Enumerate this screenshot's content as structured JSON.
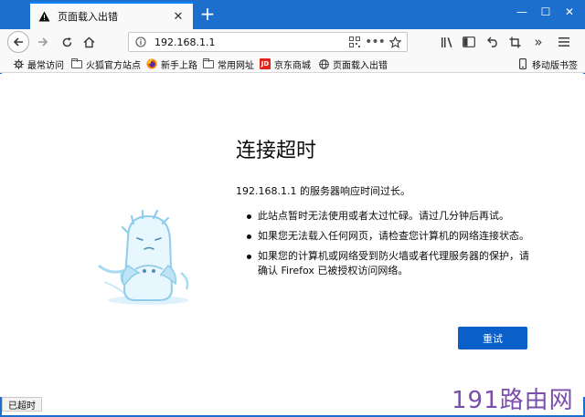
{
  "tab": {
    "title": "页面载入出错",
    "close": "✕"
  },
  "newtab": "+",
  "window": {
    "minimize": "—",
    "maximize": "☐",
    "close": "✕"
  },
  "nav": {
    "url": "192.168.1.1"
  },
  "bookmarks": [
    {
      "label": "最常访问",
      "icon": "gear-icon"
    },
    {
      "label": "火狐官方站点",
      "icon": "folder-icon"
    },
    {
      "label": "新手上路",
      "icon": "firefox-icon"
    },
    {
      "label": "常用网址",
      "icon": "folder-icon"
    },
    {
      "label": "京东商城",
      "icon": "jd-icon"
    },
    {
      "label": "页面载入出错",
      "icon": "globe-icon"
    }
  ],
  "mobile_bookmarks": "移动版书签",
  "error": {
    "title": "连接超时",
    "description": "192.168.1.1 的服务器响应时间过长。",
    "tips": [
      "此站点暂时无法使用或者太过忙碌。请过几分钟后再试。",
      "如果您无法载入任何网页，请检查您计算机的网络连接状态。",
      "如果您的计算机或网络受到防火墙或者代理服务器的保护，请确认 Firefox 已被授权访问网络。"
    ],
    "retry": "重试"
  },
  "status": "已超时",
  "watermark": "191路由网",
  "colors": {
    "accent": "#1d6fce",
    "button": "#0a60c8",
    "watermark": "#7a4eaa"
  }
}
